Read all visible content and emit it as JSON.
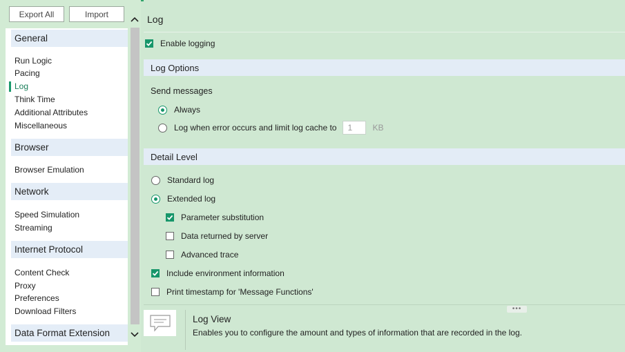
{
  "toolbar": {
    "export_all": "Export All",
    "import": "Import"
  },
  "nav": {
    "groups": [
      {
        "header": "General",
        "items": [
          "Run Logic",
          "Pacing",
          "Log",
          "Think Time",
          "Additional Attributes",
          "Miscellaneous"
        ]
      },
      {
        "header": "Browser",
        "items": [
          "Browser Emulation"
        ]
      },
      {
        "header": "Network",
        "items": [
          "Speed Simulation",
          "Streaming"
        ]
      },
      {
        "header": "Internet Protocol",
        "items": [
          "Content Check",
          "Proxy",
          "Preferences",
          "Download Filters"
        ]
      },
      {
        "header": "Data Format Extension",
        "items": []
      }
    ],
    "active_item": "Log"
  },
  "page": {
    "title": "Log"
  },
  "enable_logging": {
    "label": "Enable logging",
    "checked": true
  },
  "log_options": {
    "header": "Log Options",
    "send_messages_label": "Send messages",
    "always_label": "Always",
    "always_selected": true,
    "on_error_label": "Log when error occurs and limit log cache to",
    "on_error_selected": false,
    "cache_size": "1",
    "cache_unit": "KB"
  },
  "detail_level": {
    "header": "Detail Level",
    "standard_label": "Standard log",
    "standard_selected": false,
    "extended_label": "Extended log",
    "extended_selected": true,
    "param_sub_label": "Parameter substitution",
    "param_sub_checked": true,
    "data_returned_label": "Data returned by server",
    "data_returned_checked": false,
    "advanced_trace_label": "Advanced trace",
    "advanced_trace_checked": false,
    "include_env_label": "Include environment information",
    "include_env_checked": true,
    "print_timestamp_label": "Print timestamp for 'Message Functions'",
    "print_timestamp_checked": false
  },
  "help": {
    "grip": "•••",
    "title": "Log View",
    "text": "Enables you to configure the amount and types of information that are recorded in the log."
  },
  "colors": {
    "accent": "#16966a",
    "pane_bg": "#cfe8d2",
    "section_bg": "#e3ecf6"
  },
  "icons": {
    "help": "message-bubble-icon",
    "scroll_up": "chevron-up-icon",
    "scroll_down": "chevron-down-icon",
    "check": "check-icon"
  }
}
